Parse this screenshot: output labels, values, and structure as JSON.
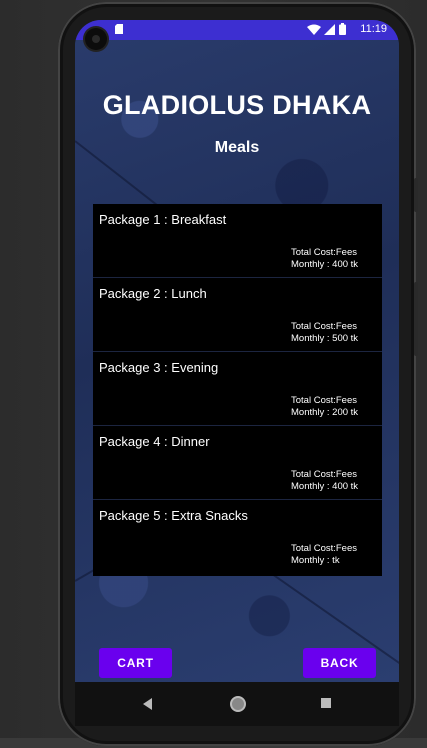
{
  "status_bar": {
    "time": "11:19",
    "icons": [
      "alert-dot-icon",
      "sim-card-icon",
      "wifi-icon",
      "signal-icon",
      "battery-icon"
    ]
  },
  "app": {
    "title": "GLADIOLUS DHAKA",
    "subtitle": "Meals"
  },
  "packages": [
    {
      "name": "Package 1 : Breakfast",
      "cost_line1": "Total Cost:Fees",
      "cost_line2": "Monthly : 400 tk"
    },
    {
      "name": "Package 2 : Lunch",
      "cost_line1": "Total Cost:Fees",
      "cost_line2": "Monthly : 500 tk"
    },
    {
      "name": "Package 3 : Evening",
      "cost_line1": "Total Cost:Fees",
      "cost_line2": "Monthly : 200 tk"
    },
    {
      "name": "Package 4 : Dinner",
      "cost_line1": "Total Cost:Fees",
      "cost_line2": "Monthly : 400 tk"
    },
    {
      "name": "Package 5 : Extra Snacks",
      "cost_line1": "Total Cost:Fees",
      "cost_line2": "Monthly :  tk"
    }
  ],
  "buttons": {
    "cart": "CART",
    "back": "BACK"
  },
  "nav_bar": {
    "icons": [
      "back-triangle-icon",
      "home-circle-icon",
      "recents-square-icon"
    ]
  },
  "colors": {
    "status_bar": "#3d2fd1",
    "button": "#6a00ee",
    "list_background": "#000000"
  }
}
